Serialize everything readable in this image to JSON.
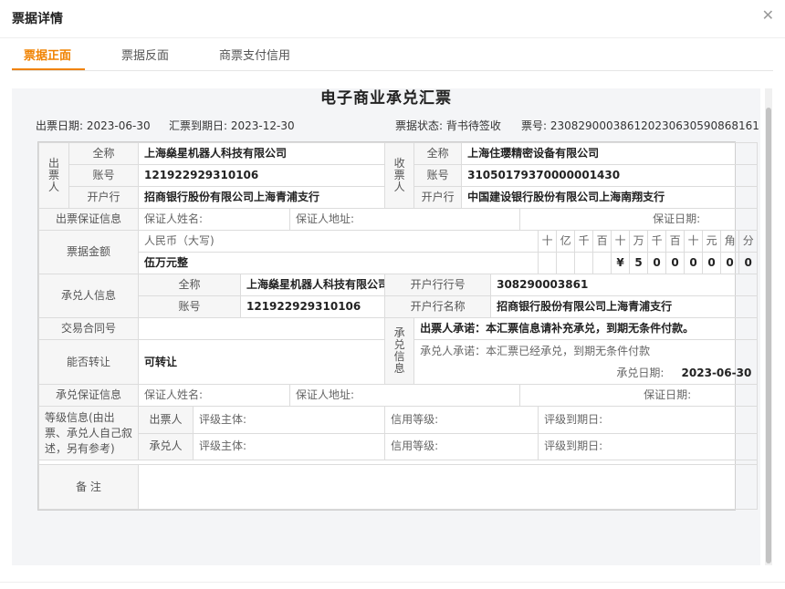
{
  "dialog": {
    "title": "票据详情"
  },
  "tabs": [
    "票据正面",
    "票据反面",
    "商票支付信用"
  ],
  "doc": {
    "title": "电子商业承兑汇票"
  },
  "meta": {
    "issue_date_label": "出票日期:",
    "issue_date": "2023-06-30",
    "due_date_label": "汇票到期日:",
    "due_date": "2023-12-30",
    "status_label": "票据状态:",
    "status": "背书待签收",
    "no_label": "票号:",
    "no": "230829000386120230630590868161"
  },
  "drawer": {
    "group": "出票人",
    "name_label": "全称",
    "name": "上海燊星机器人科技有限公司",
    "acct_label": "账号",
    "acct": "121922929310106",
    "bank_label": "开户行",
    "bank": "招商银行股份有限公司上海青浦支行"
  },
  "payee": {
    "group": "收票人",
    "name_label": "全称",
    "name": "上海住璎精密设备有限公司",
    "acct_label": "账号",
    "acct": "31050179370000001430",
    "bank_label": "开户行",
    "bank": "中国建设银行股份有限公司上海南翔支行"
  },
  "guarantee": {
    "label": "出票保证信息",
    "name_label": "保证人姓名:",
    "addr_label": "保证人地址:",
    "date_label": "保证日期:"
  },
  "amount": {
    "label": "票据金额",
    "rmb_label": "人民币（大写)",
    "amount_cn": "伍万元整",
    "units": [
      "十",
      "亿",
      "千",
      "百",
      "十",
      "万",
      "千",
      "百",
      "十",
      "元",
      "角",
      "分"
    ],
    "digits": [
      "",
      "",
      "",
      "",
      "¥",
      "5",
      "0",
      "0",
      "0",
      "0",
      "0",
      "0"
    ]
  },
  "acceptor": {
    "label": "承兑人信息",
    "name_label": "全称",
    "name": "上海燊星机器人科技有限公司",
    "acct_label": "账号",
    "acct": "121922929310106",
    "bankno_label": "开户行行号",
    "bankno": "308290003861",
    "bankname_label": "开户行名称",
    "bankname": "招商银行股份有限公司上海青浦支行"
  },
  "contract": {
    "label": "交易合同号",
    "value": ""
  },
  "transfer": {
    "label": "能否转让",
    "value": "可转让"
  },
  "accept_info": {
    "label": "承兑信息",
    "drawer_promise": "出票人承诺：本汇票信息请补充承兑，到期无条件付款。",
    "acceptor_promise": "承兑人承诺：本汇票已经承兑，到期无条件付款",
    "accept_date_label": "承兑日期:",
    "accept_date": "2023-06-30"
  },
  "acc_guarantee": {
    "label": "承兑保证信息",
    "name_label": "保证人姓名:",
    "addr_label": "保证人地址:",
    "date_label": "保证日期:"
  },
  "rating": {
    "label": "等级信息(由出票、承兑人自己叙述，另有参考)",
    "rows": [
      {
        "role": "出票人",
        "subj_label": "评级主体:",
        "level_label": "信用等级:",
        "due_label": "评级到期日:"
      },
      {
        "role": "承兑人",
        "subj_label": "评级主体:",
        "level_label": "信用等级:",
        "due_label": "评级到期日:"
      }
    ]
  },
  "remark": {
    "label": "备 注",
    "value": ""
  }
}
